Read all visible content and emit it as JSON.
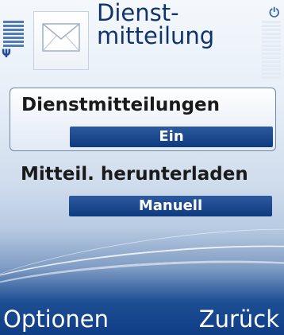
{
  "header": {
    "title_line1": "Dienst-",
    "title_line2": "mitteilung",
    "icon": "envelope-icon"
  },
  "settings": [
    {
      "label": "Dienstmitteilungen",
      "value": "Ein",
      "selected": true
    },
    {
      "label": "Mitteil. herunterladen",
      "value": "Manuell",
      "selected": false
    }
  ],
  "softkeys": {
    "left": "Optionen",
    "right": "Zurück"
  },
  "colors": {
    "title": "#10336e",
    "value_field": "#0e3a80",
    "selection_border": "#6f87ab",
    "softkey_text": "#ffffff"
  }
}
